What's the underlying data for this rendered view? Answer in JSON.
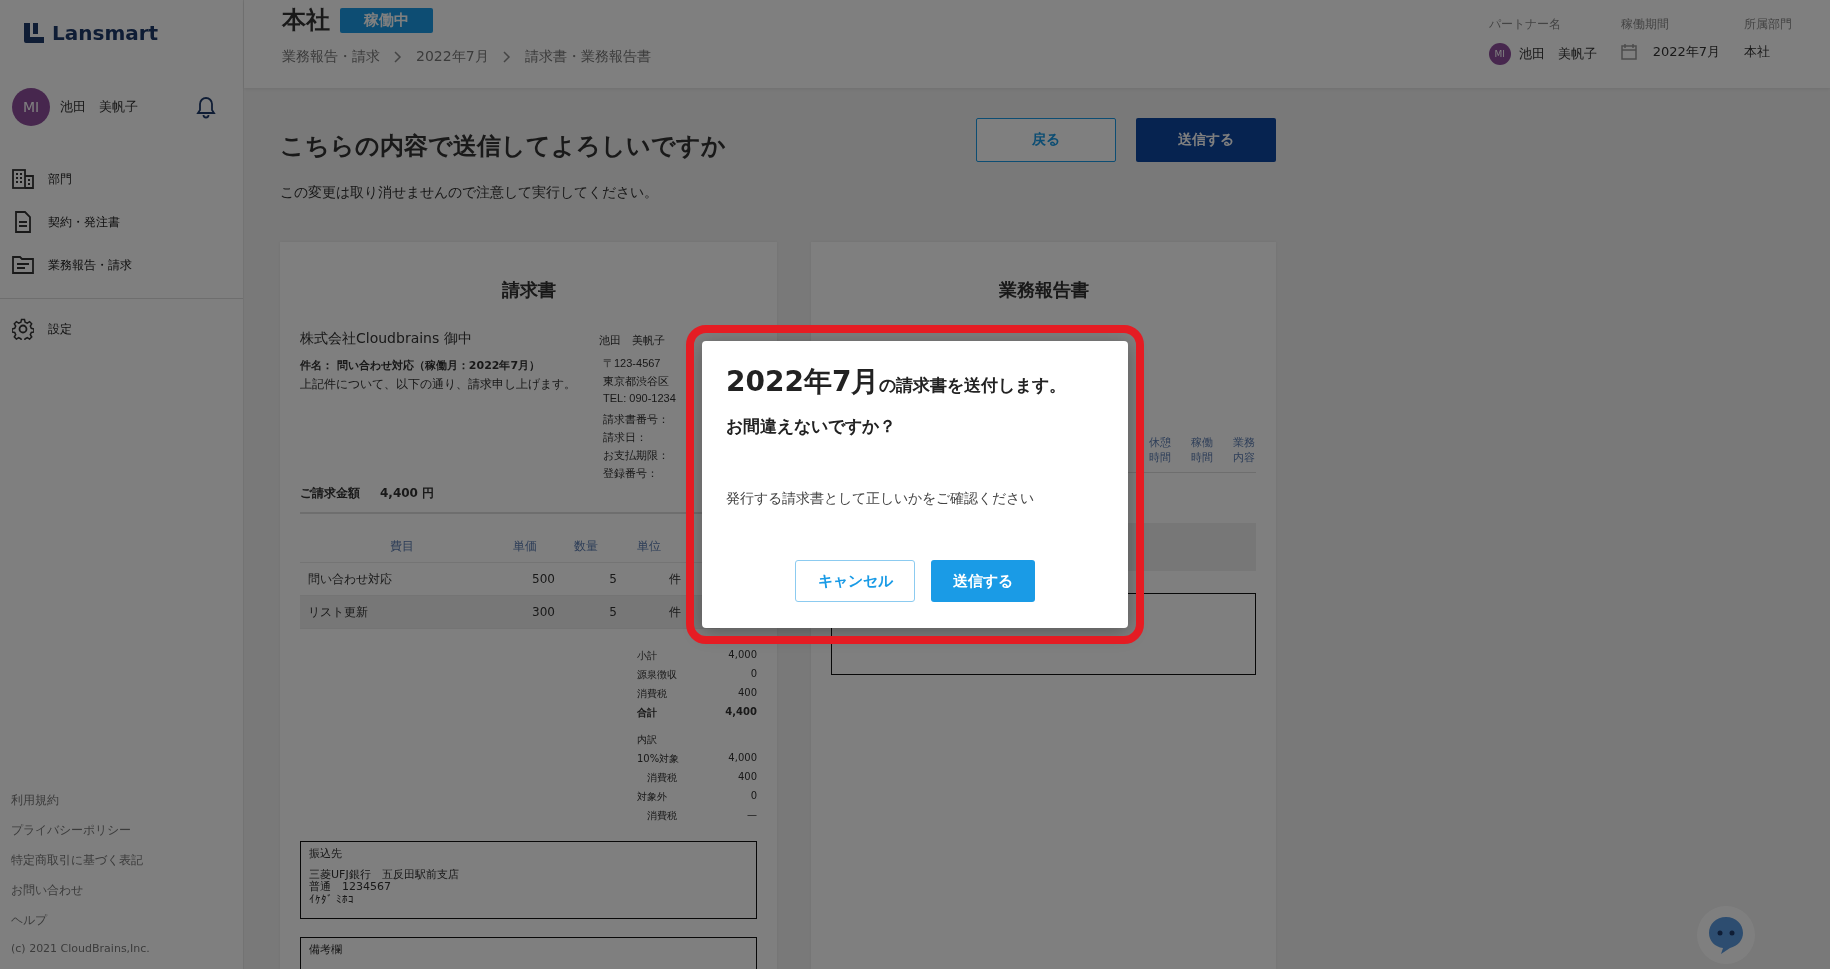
{
  "sidebar": {
    "logo": "Lansmart",
    "user": {
      "initials": "MI",
      "name": "池田　美帆子"
    },
    "nav": [
      {
        "label": "部門"
      },
      {
        "label": "契約・発注書"
      },
      {
        "label": "業務報告・請求"
      }
    ],
    "settings": {
      "label": "設定"
    },
    "footer_links": [
      "利用規約",
      "プライバシーポリシー",
      "特定商取引に基づく表記",
      "お問い合わせ",
      "ヘルプ"
    ],
    "copyright": "(c) 2021 CloudBrains,Inc."
  },
  "header": {
    "title": "本社",
    "status": "稼働中",
    "breadcrumb": [
      "業務報告・請求",
      "2022年7月",
      "請求書・業務報告書"
    ],
    "partner": {
      "label": "パートナー名",
      "initials": "MI",
      "value": "池田　美帆子"
    },
    "period": {
      "label": "稼働期間",
      "value": "2022年7月"
    },
    "department": {
      "label": "所属部門",
      "value": "本社"
    }
  },
  "page": {
    "heading": "こちらの内容で送信してよろしいですか",
    "note": "この変更は取り消せませんので注意して実行してください。",
    "back_button": "戻る",
    "send_button": "送信する"
  },
  "invoice": {
    "title": "請求書",
    "addressee": "株式会社Cloudbrains 御中",
    "subject": "件名： 問い合わせ対応（稼働月：2022年7月）",
    "intro": "上記件について、以下の通り、請求申し上げます。",
    "issuer_name": "池田　美帆子",
    "issuer_lines": [
      "〒123-4567",
      "東京都渋谷区",
      "TEL: 090-1234"
    ],
    "meta_labels": [
      "請求書番号：",
      "請求日：",
      "お支払期限：",
      "登録番号："
    ],
    "total_label": "ご請求金額",
    "total_value": "4,400 円",
    "columns": [
      "費目",
      "単価",
      "数量",
      "単位"
    ],
    "rows": [
      {
        "item": "問い合わせ対応",
        "unit_price": "500",
        "quantity": "5",
        "unit": "件"
      },
      {
        "item": "リスト更新",
        "unit_price": "300",
        "quantity": "5",
        "unit": "件"
      }
    ],
    "summary": [
      {
        "kind": "normal",
        "label": "小計",
        "value": "4,000"
      },
      {
        "kind": "normal",
        "label": "源泉徴収",
        "value": "0"
      },
      {
        "kind": "normal",
        "label": "消費税",
        "value": "400"
      },
      {
        "kind": "bold",
        "label": "合計",
        "value": "4,400"
      },
      {
        "kind": "heading",
        "label": "内訳"
      },
      {
        "kind": "normal",
        "label": "10%対象",
        "value": "4,000"
      },
      {
        "kind": "indent",
        "label": "消費税",
        "value": "400"
      },
      {
        "kind": "normal",
        "label": "対象外",
        "value": "0"
      },
      {
        "kind": "indent",
        "label": "消費税",
        "value": "—"
      }
    ],
    "bank": {
      "title": "振込先",
      "lines": [
        "三菱UFJ銀行　五反田駅前支店",
        "普通　1234567",
        "ｲｹﾀﾞ ﾐﾎｺ"
      ]
    },
    "remarks_title": "備考欄"
  },
  "report": {
    "title": "業務報告書",
    "columns": [
      "休憩時間",
      "稼働時間",
      "業務内容"
    ]
  },
  "modal": {
    "month": "2022年7月",
    "title_rest": "の請求書を送付します。",
    "subtitle": "お間違えないですか？",
    "message": "発行する請求書として正しいかをご確認ください",
    "cancel_button": "キャンセル",
    "confirm_button": "送信する"
  }
}
